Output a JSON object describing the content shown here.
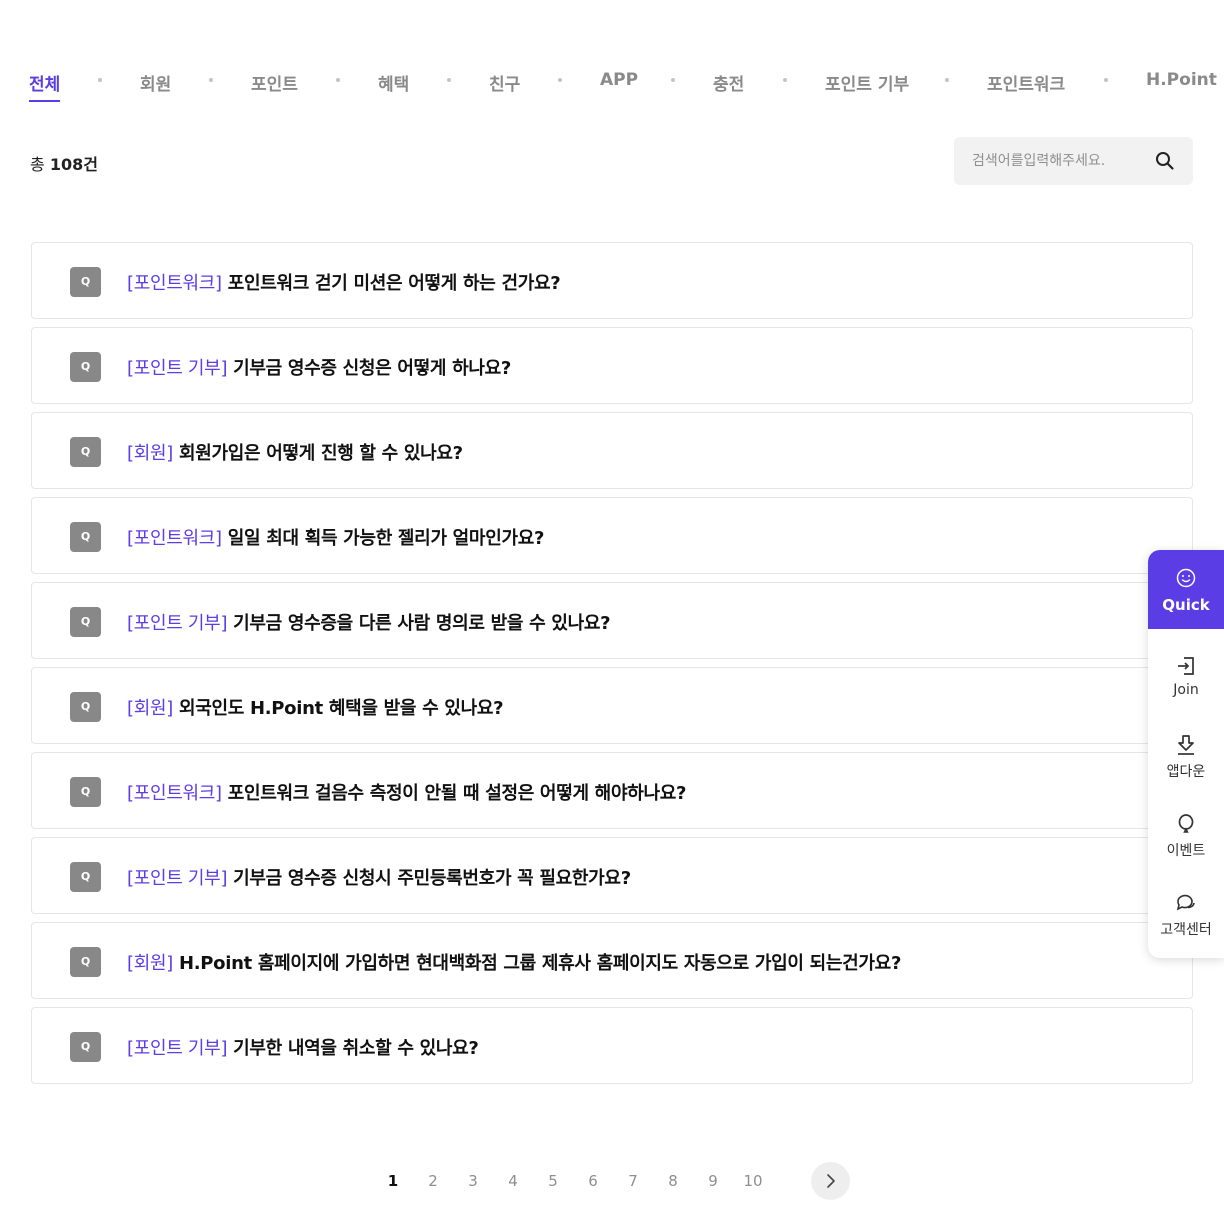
{
  "tabs": [
    {
      "label": "전체",
      "active": true
    },
    {
      "label": "회원"
    },
    {
      "label": "포인트"
    },
    {
      "label": "혜택"
    },
    {
      "label": "친구"
    },
    {
      "label": "APP"
    },
    {
      "label": "충전"
    },
    {
      "label": "포인트 기부"
    },
    {
      "label": "포인트워크"
    },
    {
      "label": "H.Point P"
    }
  ],
  "summary": {
    "prefix": "총",
    "count": "108건"
  },
  "search": {
    "placeholder": "검색어를입력해주세요.",
    "icon": "search-icon"
  },
  "faq": {
    "badge": "Q",
    "items": [
      {
        "category": "[포인트워크]",
        "question": "포인트워크 걷기 미션은 어떻게 하는 건가요?"
      },
      {
        "category": "[포인트 기부]",
        "question": "기부금 영수증 신청은 어떻게 하나요?"
      },
      {
        "category": "[회원]",
        "question": "회원가입은 어떻게 진행 할 수 있나요?"
      },
      {
        "category": "[포인트워크]",
        "question": "일일 최대 획득 가능한 젤리가 얼마인가요?"
      },
      {
        "category": "[포인트 기부]",
        "question": "기부금 영수증을 다른 사람 명의로 받을 수 있나요?"
      },
      {
        "category": "[회원]",
        "question": "외국인도 H.Point 혜택을 받을 수 있나요?"
      },
      {
        "category": "[포인트워크]",
        "question": "포인트워크 걸음수 측정이 안될 때 설정은 어떻게 해야하나요?"
      },
      {
        "category": "[포인트 기부]",
        "question": "기부금 영수증 신청시 주민등록번호가 꼭 필요한가요?"
      },
      {
        "category": "[회원]",
        "question": "H.Point 홈페이지에 가입하면 현대백화점 그룹 제휴사 홈페이지도 자동으로 가입이 되는건가요?"
      },
      {
        "category": "[포인트 기부]",
        "question": "기부한 내역을 취소할 수 있나요?"
      }
    ]
  },
  "pagination": {
    "pages": [
      "1",
      "2",
      "3",
      "4",
      "5",
      "6",
      "7",
      "8",
      "9",
      "10"
    ],
    "current": "1",
    "next_icon": "chevron-right-icon"
  },
  "quick_menu": {
    "title": "Quick",
    "items": [
      {
        "label": "Join",
        "icon": "login-icon"
      },
      {
        "label": "앱다운",
        "icon": "download-icon"
      },
      {
        "label": "이벤트",
        "icon": "balloon-icon"
      },
      {
        "label": "고객센터",
        "icon": "chat-icon"
      }
    ]
  },
  "colors": {
    "accent": "#5b3de6",
    "badge": "#888888"
  }
}
